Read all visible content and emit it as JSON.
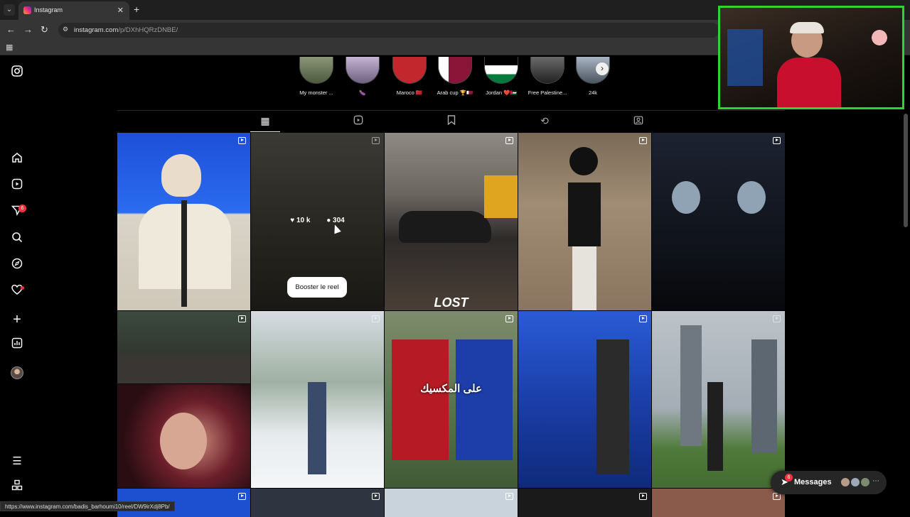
{
  "browser": {
    "tab_title": "Instagram",
    "new_tab": "+",
    "url_host": "instagram.com",
    "url_path": "/p/DXhHQRzDNBE/",
    "status_url": "https://www.instagram.com/badis_barhoumi10/reel/DW9irXdj8Pb/"
  },
  "highlights": [
    {
      "label": "My monster ...",
      "color": "#9aa58c"
    },
    {
      "label": "🍆",
      "color": "#b8a6c4"
    },
    {
      "label": "Maroco 🇲🇦",
      "color": "#c1272d"
    },
    {
      "label": "Arab cup 🏆🇶🇦",
      "color": "#8a1538"
    },
    {
      "label": "Jordan ❤️🇯🇴",
      "color": "#ce1126"
    },
    {
      "label": "Free Palestine...",
      "color": "#4a4a4a"
    },
    {
      "label": "24k",
      "color": "#8e9aa8"
    }
  ],
  "profile_tabs": [
    "posts-tab",
    "reels-tab",
    "saved-tab",
    "reposts-tab",
    "tagged-tab"
  ],
  "grid": {
    "hover_likes": "10 k",
    "hover_comments": "304",
    "boost_label": "Booster le reel",
    "caption_lost": "LOST",
    "caption_arabic": "على المكسيك"
  },
  "messages": {
    "label": "Messages",
    "badge": "6"
  },
  "sidebar": {
    "notification_badge": "6"
  },
  "colors": {
    "background": "#000000",
    "accent_red": "#ff3040",
    "webcam_border": "#2fd52f"
  }
}
